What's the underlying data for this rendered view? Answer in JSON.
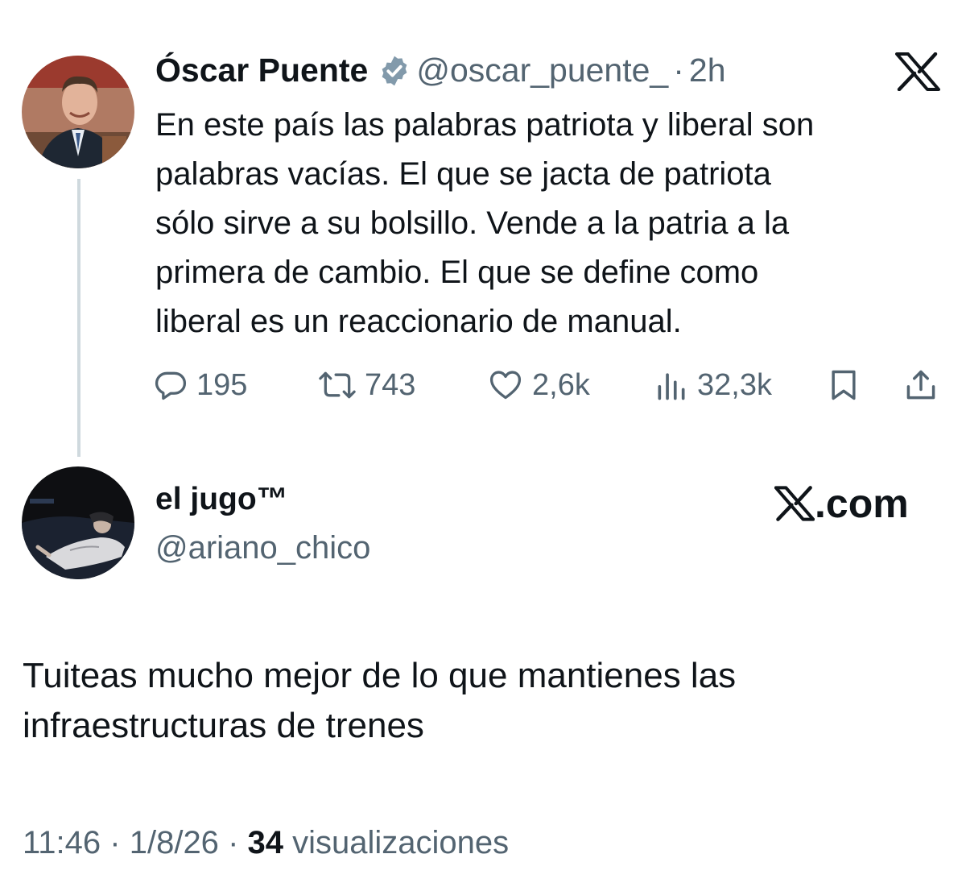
{
  "original_tweet": {
    "author_name": "Óscar Puente",
    "handle": "@oscar_puente_",
    "separator": "·",
    "time": "2h",
    "platform_logo": "x-logo-icon",
    "text": "En este país las palabras patriota y liberal son\npalabras vacías. El que se jacta de patriota\nsólo sirve a su bolsillo. Vende a la patria a la\nprimera de cambio. El que se define como\nliberal es un reaccionario de manual.",
    "metrics": {
      "replies": "195",
      "retweets": "743",
      "likes": "2,6k",
      "views": "32,3k"
    },
    "icons": {
      "reply": "reply-icon",
      "retweet": "retweet-icon",
      "like": "heart-icon",
      "views": "views-icon",
      "bookmark": "bookmark-icon",
      "share": "share-icon",
      "verified": "verified-badge-icon"
    }
  },
  "reply_tweet": {
    "author_name": "el jugo™",
    "handle": "@ariano_chico",
    "brand": ".com",
    "text": "Tuiteas mucho mejor de lo que mantienes las infraestructuras de trenes",
    "time": "11:46",
    "date": "1/8/26",
    "separator": "·",
    "views_count": "34",
    "views_label": "visualizaciones"
  },
  "colors": {
    "text": "#0f1419",
    "secondary": "#536471",
    "verified_badge": "#829aab",
    "thread_line": "#cfd9de"
  }
}
